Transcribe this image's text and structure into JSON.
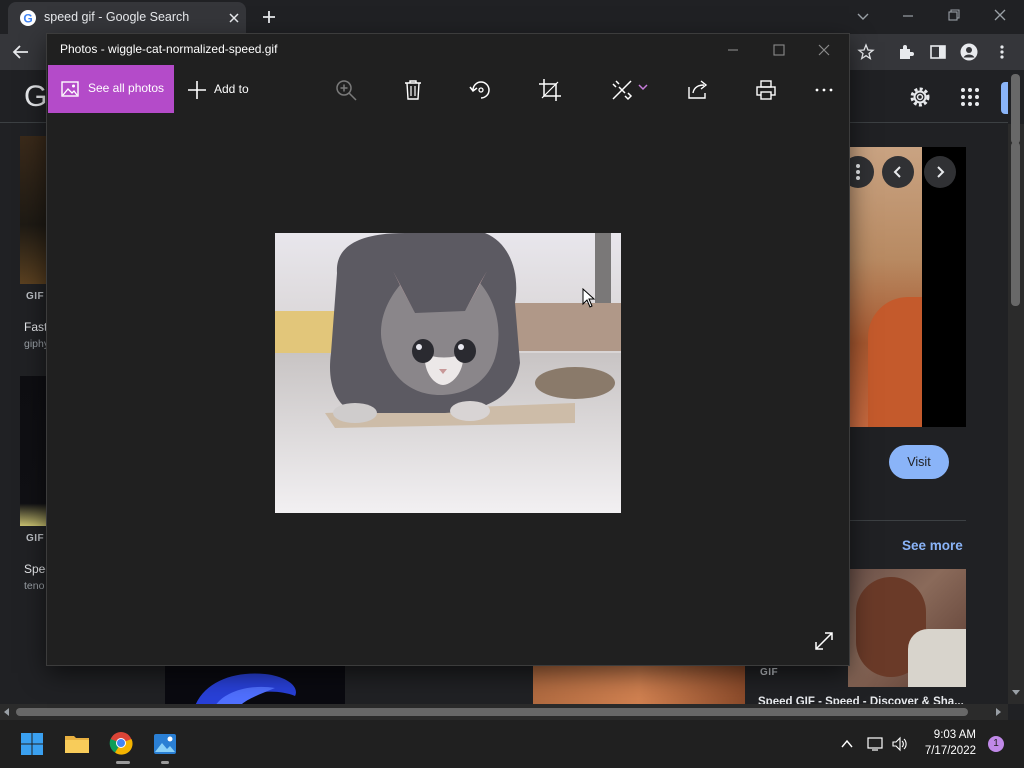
{
  "browser": {
    "tab_title": "speed gif - Google Search",
    "logo_letter": "G"
  },
  "results": {
    "left_col": [
      {
        "badge": "GIF",
        "title": "Fast",
        "source": "giphy"
      },
      {
        "badge": "GIF",
        "title": "Spee",
        "source": "teno"
      }
    ],
    "right_panel": {
      "visit_label": "Visit",
      "see_more_label": "See more",
      "related_badge": "GIF",
      "related_title": "Speed GIF - Speed - Discover & Sha..."
    }
  },
  "photos": {
    "window_title": "Photos - wiggle-cat-normalized-speed.gif",
    "see_all_label": "See all photos",
    "add_to_label": "Add to",
    "toolbar_icons": [
      "zoom-in-icon",
      "delete-icon",
      "rotate-icon",
      "crop-icon",
      "edit-icon",
      "share-icon",
      "print-icon",
      "more-icon"
    ]
  },
  "taskbar": {
    "time": "9:03 AM",
    "date": "7/17/2022",
    "notification_count": "1"
  },
  "colors": {
    "accent": "#b44bc9",
    "visit_button": "#8ab4f8",
    "link": "#8ab4f8"
  }
}
